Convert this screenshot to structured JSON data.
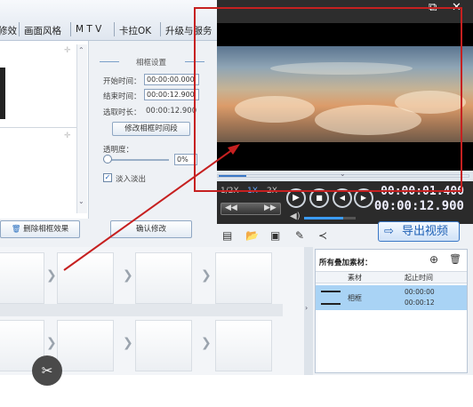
{
  "tabs": [
    "修效",
    "画面风格",
    "M T V",
    "卡拉OK",
    "升级与服务"
  ],
  "window_controls": {
    "restore": "⧉",
    "close": "✕"
  },
  "settings": {
    "title": "相框设置",
    "start_label": "开始时间：",
    "start_value": "00:00:00.000",
    "end_label": "结束时间：",
    "end_value": "00:00:12.900",
    "duration_label": "选取时长：",
    "duration_value": "00:00:12.900",
    "modify_time_button": "修改相框时间段",
    "opacity_label": "透明度：",
    "opacity_value": "0%",
    "fade_label": "淡入淡出",
    "confirm_button": "确认修改"
  },
  "left": {
    "delete_button": "删除相框效果"
  },
  "player": {
    "speeds": [
      "1/2X",
      "1X",
      "2X"
    ],
    "current_time": "00:00:01.400",
    "total_time": "00:00:12.900",
    "progress": 0.11,
    "volume": 0.75
  },
  "toolbar": {
    "export_label": "导出视频"
  },
  "added": {
    "title": "所有叠加素材：",
    "col_material": "素材",
    "col_time": "起止时间",
    "row_name": "相框",
    "row_start": "00:00:00",
    "row_end": "00:00:12"
  },
  "colors": {
    "accent": "#3b78c6",
    "annotation": "#c62020"
  }
}
